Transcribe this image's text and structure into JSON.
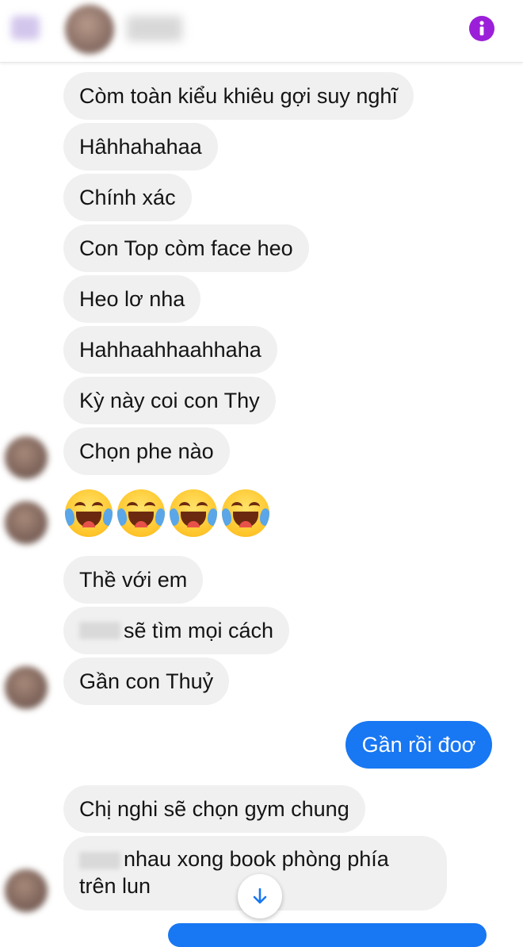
{
  "header": {
    "icons": {
      "back": "back-arrow-icon",
      "info": "info-icon"
    },
    "accent_color": "#9b1fd8"
  },
  "messages": {
    "m1": "Còm toàn kiểu khiêu gợi suy nghĩ",
    "m2": "Hâhhahahaa",
    "m3": "Chính xác",
    "m4": "Con Top còm face heo",
    "m5": "Heo lơ nha",
    "m6": "Hahhaahhaahhaha",
    "m7": "Kỳ này coi con Thy",
    "m8": "Chọn phe nào",
    "m10": "Thề với em",
    "m11": "sẽ tìm mọi cách",
    "m12": "Gần con Thuỷ",
    "m13": "Gần rồi đoơ",
    "m14": "Chị nghi sẽ chọn gym chung",
    "m15": "nhau xong book phòng phía trên lun"
  },
  "emoji": {
    "count": 4,
    "name": "face-with-tears-of-joy-emoji"
  },
  "colors": {
    "received_bubble": "#f0f0f0",
    "sent_bubble": "#1877f2",
    "text": "#141414"
  },
  "scroll_button": {
    "icon": "arrow-down-icon"
  }
}
